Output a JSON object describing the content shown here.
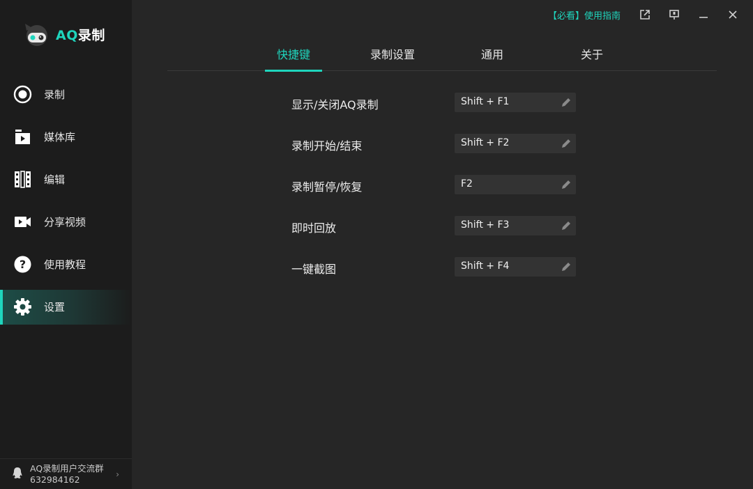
{
  "app": {
    "name_prefix": "AQ",
    "name_suffix": "录制"
  },
  "titlebar": {
    "guide_link": "【必看】使用指南"
  },
  "sidebar": {
    "items": [
      {
        "label": "录制",
        "icon": "record-icon"
      },
      {
        "label": "媒体库",
        "icon": "media-library-icon"
      },
      {
        "label": "编辑",
        "icon": "film-edit-icon"
      },
      {
        "label": "分享视频",
        "icon": "video-camera-icon"
      },
      {
        "label": "使用教程",
        "icon": "question-icon"
      },
      {
        "label": "设置",
        "icon": "gear-icon",
        "active": true
      }
    ],
    "community": {
      "title": "AQ录制用户交流群",
      "number": "632984162"
    }
  },
  "tabs": [
    {
      "label": "快捷键",
      "active": true
    },
    {
      "label": "录制设置"
    },
    {
      "label": "通用"
    },
    {
      "label": "关于"
    }
  ],
  "shortcuts": [
    {
      "label": "显示/关闭AQ录制",
      "key": "Shift + F1"
    },
    {
      "label": "录制开始/结束",
      "key": "Shift + F2"
    },
    {
      "label": "录制暂停/恢复",
      "key": "F2"
    },
    {
      "label": "即时回放",
      "key": "Shift + F3"
    },
    {
      "label": "一键截图",
      "key": "Shift + F4"
    }
  ],
  "colors": {
    "accent": "#1fd5bd",
    "sidebar_bg": "#1c1c1c",
    "main_bg": "#262626",
    "field_bg": "#333333"
  }
}
